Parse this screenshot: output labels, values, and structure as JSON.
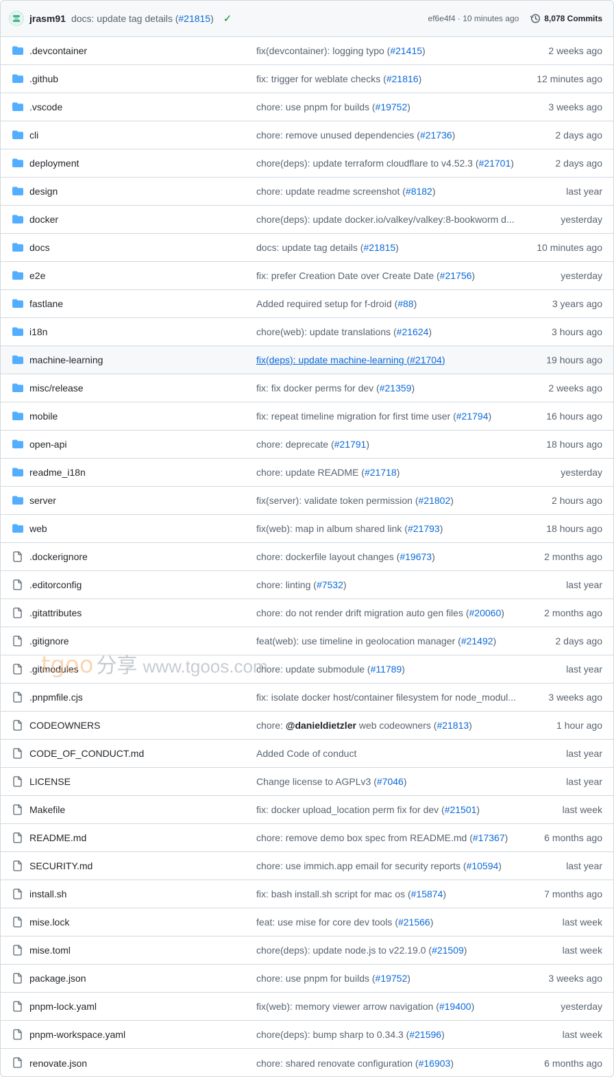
{
  "latest_commit": {
    "author": "jrasm91",
    "message": "docs: update tag details (",
    "pr": "#21815",
    "message_end": ")",
    "status": "✓",
    "sha_time": "ef6e4f4 · 10 minutes ago",
    "commits_label": "8,078 Commits"
  },
  "files": [
    {
      "type": "folder-icon",
      "name": ".devcontainer",
      "pre": "fix(devcontainer): logging typo (",
      "pr": "#21415",
      "post": ")",
      "age": "2 weeks ago"
    },
    {
      "type": "folder-icon",
      "name": ".github",
      "pre": "fix: trigger for weblate checks (",
      "pr": "#21816",
      "post": ")",
      "age": "12 minutes ago"
    },
    {
      "type": "folder-icon",
      "name": ".vscode",
      "pre": "chore: use pnpm for builds (",
      "pr": "#19752",
      "post": ")",
      "age": "3 weeks ago"
    },
    {
      "type": "folder-icon",
      "name": "cli",
      "pre": "chore: remove unused dependencies (",
      "pr": "#21736",
      "post": ")",
      "age": "2 days ago"
    },
    {
      "type": "folder-icon",
      "name": "deployment",
      "pre": "chore(deps): update terraform cloudflare to v4.52.3 (",
      "pr": "#21701",
      "post": ")",
      "age": "2 days ago"
    },
    {
      "type": "folder-icon",
      "name": "design",
      "pre": "chore: update readme screenshot (",
      "pr": "#8182",
      "post": ")",
      "age": "last year"
    },
    {
      "type": "folder-icon",
      "name": "docker",
      "pre": "chore(deps): update docker.io/valkey/valkey:8-bookworm d...",
      "pr": "",
      "post": "",
      "age": "yesterday"
    },
    {
      "type": "folder-icon",
      "name": "docs",
      "pre": "docs: update tag details (",
      "pr": "#21815",
      "post": ")",
      "age": "10 minutes ago"
    },
    {
      "type": "folder-icon",
      "name": "e2e",
      "pre": "fix: prefer Creation Date over Create Date (",
      "pr": "#21756",
      "post": ")",
      "age": "yesterday"
    },
    {
      "type": "folder-icon",
      "name": "fastlane",
      "pre": "Added required setup for f-droid (",
      "pr": "#88",
      "post": ")",
      "age": "3 years ago"
    },
    {
      "type": "folder-icon",
      "name": "i18n",
      "pre": "chore(web): update translations (",
      "pr": "#21624",
      "post": ")",
      "age": "3 hours ago"
    },
    {
      "type": "folder-icon",
      "name": "machine-learning",
      "pre": "fix(deps): update machine-learning (",
      "pr": "#21704",
      "post": ")",
      "age": "19 hours ago",
      "hover": true
    },
    {
      "type": "folder-icon",
      "name": "misc/release",
      "pre": "fix: fix docker perms for dev (",
      "pr": "#21359",
      "post": ")",
      "age": "2 weeks ago"
    },
    {
      "type": "folder-icon",
      "name": "mobile",
      "pre": "fix: repeat timeline migration for first time user (",
      "pr": "#21794",
      "post": ")",
      "age": "16 hours ago"
    },
    {
      "type": "folder-icon",
      "name": "open-api",
      "pre": "chore: deprecate (",
      "pr": "#21791",
      "post": ")",
      "age": "18 hours ago"
    },
    {
      "type": "folder-icon",
      "name": "readme_i18n",
      "pre": "chore: update README (",
      "pr": "#21718",
      "post": ")",
      "age": "yesterday"
    },
    {
      "type": "folder-icon",
      "name": "server",
      "pre": "fix(server): validate token permission (",
      "pr": "#21802",
      "post": ")",
      "age": "2 hours ago"
    },
    {
      "type": "folder-icon",
      "name": "web",
      "pre": "fix(web): map in album shared link (",
      "pr": "#21793",
      "post": ")",
      "age": "18 hours ago"
    },
    {
      "type": "file-icon",
      "name": ".dockerignore",
      "pre": "chore: dockerfile layout changes (",
      "pr": "#19673",
      "post": ")",
      "age": "2 months ago"
    },
    {
      "type": "file-icon",
      "name": ".editorconfig",
      "pre": "chore: linting (",
      "pr": "#7532",
      "post": ")",
      "age": "last year"
    },
    {
      "type": "file-icon",
      "name": ".gitattributes",
      "pre": "chore: do not render drift migration auto gen files (",
      "pr": "#20060",
      "post": ")",
      "age": "2 months ago"
    },
    {
      "type": "file-icon",
      "name": ".gitignore",
      "pre": "feat(web): use timeline in geolocation manager (",
      "pr": "#21492",
      "post": ")",
      "age": "2 days ago"
    },
    {
      "type": "file-icon",
      "name": ".gitmodules",
      "pre": "chore: update submodule (",
      "pr": "#11789",
      "post": ")",
      "age": "last year"
    },
    {
      "type": "file-icon",
      "name": ".pnpmfile.cjs",
      "pre": "fix: isolate docker host/container filesystem for node_modul...",
      "pr": "",
      "post": "",
      "age": "3 weeks ago"
    },
    {
      "type": "file-icon",
      "name": "CODEOWNERS",
      "pre": "chore: ",
      "mention": "@danieldietzler",
      "pre2": " web codeowners (",
      "pr": "#21813",
      "post": ")",
      "age": "1 hour ago"
    },
    {
      "type": "file-icon",
      "name": "CODE_OF_CONDUCT.md",
      "pre": "Added Code of conduct",
      "pr": "",
      "post": "",
      "age": "last year"
    },
    {
      "type": "file-icon",
      "name": "LICENSE",
      "pre": "Change license to AGPLv3 (",
      "pr": "#7046",
      "post": ")",
      "age": "last year"
    },
    {
      "type": "file-icon",
      "name": "Makefile",
      "pre": "fix: docker upload_location perm fix for dev (",
      "pr": "#21501",
      "post": ")",
      "age": "last week"
    },
    {
      "type": "file-icon",
      "name": "README.md",
      "pre": "chore: remove demo box spec from README.md (",
      "pr": "#17367",
      "post": ")",
      "age": "6 months ago"
    },
    {
      "type": "file-icon",
      "name": "SECURITY.md",
      "pre": "chore: use immich.app email for security reports (",
      "pr": "#10594",
      "post": ")",
      "age": "last year"
    },
    {
      "type": "file-icon",
      "name": "install.sh",
      "pre": "fix: bash install.sh script for mac os (",
      "pr": "#15874",
      "post": ")",
      "age": "7 months ago"
    },
    {
      "type": "file-icon",
      "name": "mise.lock",
      "pre": "feat: use mise for core dev tools (",
      "pr": "#21566",
      "post": ")",
      "age": "last week"
    },
    {
      "type": "file-icon",
      "name": "mise.toml",
      "pre": "chore(deps): update node.js to v22.19.0 (",
      "pr": "#21509",
      "post": ")",
      "age": "last week"
    },
    {
      "type": "file-icon",
      "name": "package.json",
      "pre": "chore: use pnpm for builds (",
      "pr": "#19752",
      "post": ")",
      "age": "3 weeks ago"
    },
    {
      "type": "file-icon",
      "name": "pnpm-lock.yaml",
      "pre": "fix(web): memory viewer arrow navigation (",
      "pr": "#19400",
      "post": ")",
      "age": "yesterday"
    },
    {
      "type": "file-icon",
      "name": "pnpm-workspace.yaml",
      "pre": "chore(deps): bump sharp to 0.34.3 (",
      "pr": "#21596",
      "post": ")",
      "age": "last week"
    },
    {
      "type": "file-icon",
      "name": "renovate.json",
      "pre": "chore: shared renovate configuration (",
      "pr": "#16903",
      "post": ")",
      "age": "6 months ago"
    }
  ],
  "watermark": {
    "part1": "tgoo",
    "part2": "分享",
    "part3": "www.tgoos.com"
  },
  "colors": {
    "folder": "#54aeff",
    "file": "#59636e",
    "link": "#0969da",
    "success": "#1a7f37"
  }
}
